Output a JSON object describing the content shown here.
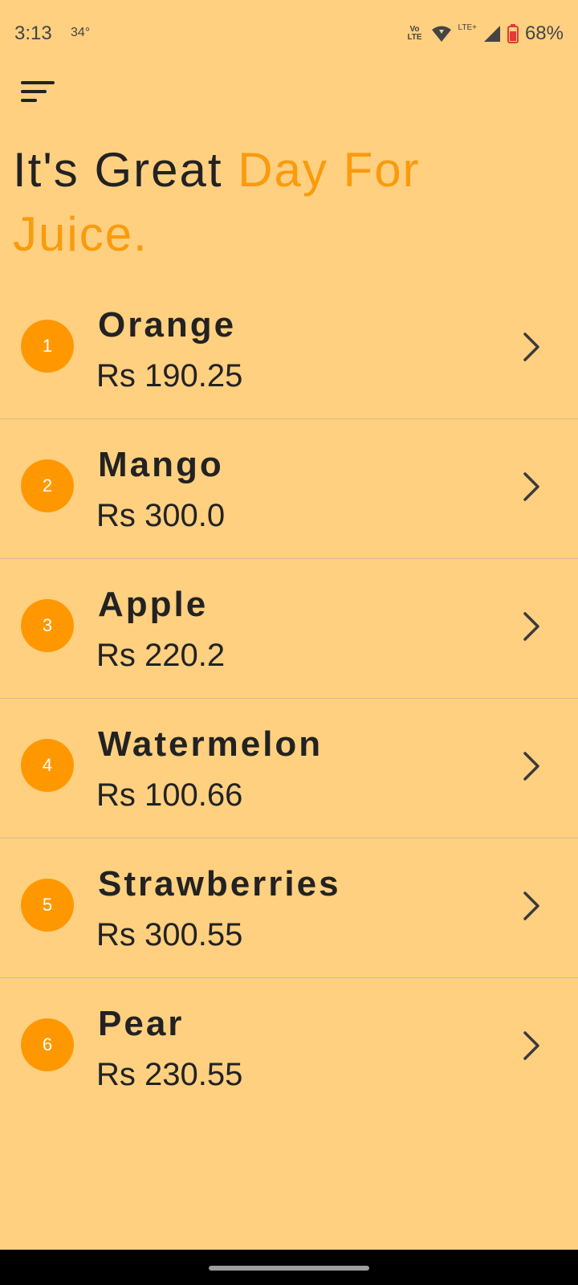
{
  "status_bar": {
    "time": "3:13",
    "temperature": "34°",
    "volte_line1": "Vo",
    "volte_line2": "LTE",
    "lte_plus": "LTE+",
    "battery": "68%"
  },
  "header": {
    "title_plain": "It's Great ",
    "title_accent": "Day For Juice."
  },
  "juices": [
    {
      "number": "1",
      "name": "Orange",
      "price": "Rs 190.25"
    },
    {
      "number": "2",
      "name": "Mango",
      "price": "Rs 300.0"
    },
    {
      "number": "3",
      "name": "Apple",
      "price": "Rs 220.2"
    },
    {
      "number": "4",
      "name": "Watermelon",
      "price": "Rs 100.66"
    },
    {
      "number": "5",
      "name": "Strawberries",
      "price": "Rs 300.55"
    },
    {
      "number": "6",
      "name": "Pear",
      "price": "Rs 230.55"
    }
  ],
  "colors": {
    "background": "#FFD080",
    "accent": "#F99B0C",
    "badge": "#FF9800",
    "text": "#222222"
  },
  "icons": {
    "menu": "sort-menu-icon",
    "row_arrow": "chevron-right-icon",
    "wifi": "wifi-icon",
    "signal": "signal-icon",
    "battery": "battery-icon"
  }
}
